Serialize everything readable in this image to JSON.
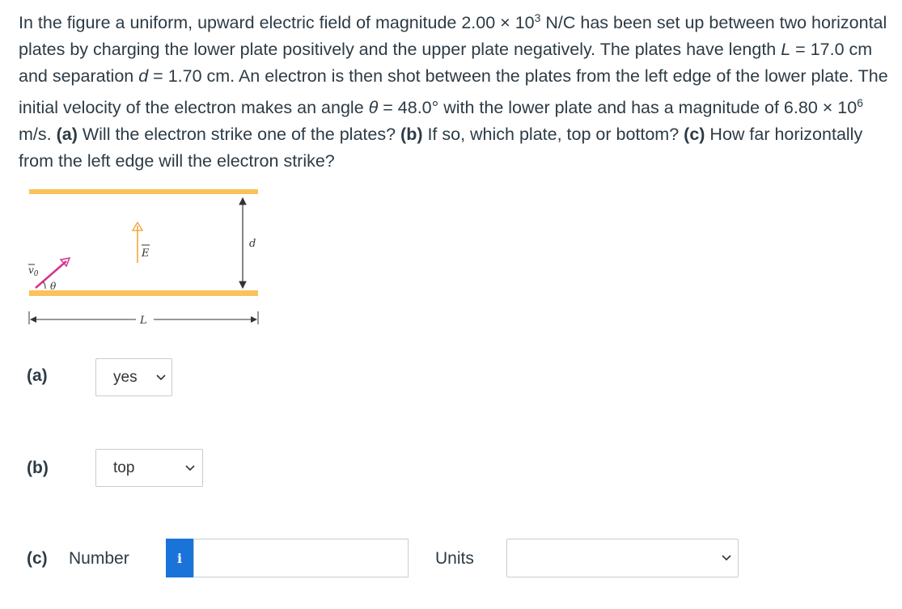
{
  "problem": {
    "p1": "In the figure a uniform, upward electric field of magnitude 2.00 × 10",
    "exp_field": "3",
    "p2": " N/C has been set up between two horizontal plates by charging the lower plate positively and the upper plate negatively. The plates have length ",
    "var_L": "L",
    "p3": " = 17.0 cm and separation ",
    "var_d": "d",
    "p4": " = 1.70 cm. An electron is then shot between the plates from the left edge of the lower plate. The initial velocity of the electron makes an angle ",
    "var_theta": "θ",
    "p5": " = 48.0° with the lower plate and has a magnitude of 6.80 × 10",
    "exp_velocity": "6",
    "p6": " m/s. ",
    "qa_label": "(a)",
    "qa_text": " Will the electron strike one of the plates? ",
    "qb_label": "(b)",
    "qb_text": " If so, which plate, top or bottom? ",
    "qc_label": "(c)",
    "qc_text": " How far horizontally from the left edge will the electron strike?"
  },
  "figure": {
    "label_v0": "v",
    "label_v0_sub": "0",
    "label_theta": "θ",
    "label_E": "E",
    "label_d": "d",
    "label_L": "L",
    "plate_color": "#f9c25a",
    "velocity_color": "#d6338f"
  },
  "answers": {
    "a": {
      "label": "(a)",
      "selected": "yes"
    },
    "b": {
      "label": "(b)",
      "selected": "top"
    },
    "c": {
      "label": "(c)",
      "number_label": "Number",
      "info_icon": "i",
      "value": "",
      "units_label": "Units",
      "units_selected": ""
    }
  }
}
